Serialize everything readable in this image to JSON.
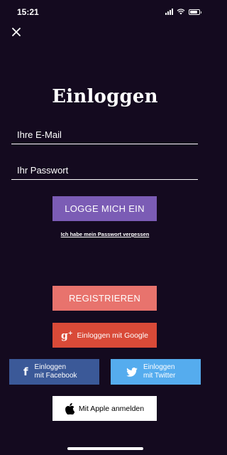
{
  "status_bar": {
    "time": "15:21"
  },
  "title": "Einloggen",
  "form": {
    "email_placeholder": "Ihre E-Mail",
    "password_placeholder": "Ihr Passwort"
  },
  "buttons": {
    "login": "LOGGE MICH EIN",
    "forgot": "Ich habe mein Passwort vergessen",
    "register": "REGISTRIEREN",
    "google": "Einloggen mit Google",
    "facebook_line1": "Einloggen",
    "facebook_line2": "mit Facebook",
    "twitter_line1": "Einloggen",
    "twitter_line2": "mit Twitter",
    "apple": "Mit Apple anmelden"
  },
  "icons": {
    "close": "close-icon",
    "google": "google-plus-icon",
    "facebook": "facebook-icon",
    "twitter": "twitter-icon",
    "apple": "apple-icon"
  },
  "colors": {
    "background": "#140a1f",
    "login": "#7b5cb5",
    "register": "#e8736d",
    "google": "#d94a38",
    "facebook": "#3b5998",
    "twitter": "#55acee",
    "apple": "#ffffff"
  }
}
